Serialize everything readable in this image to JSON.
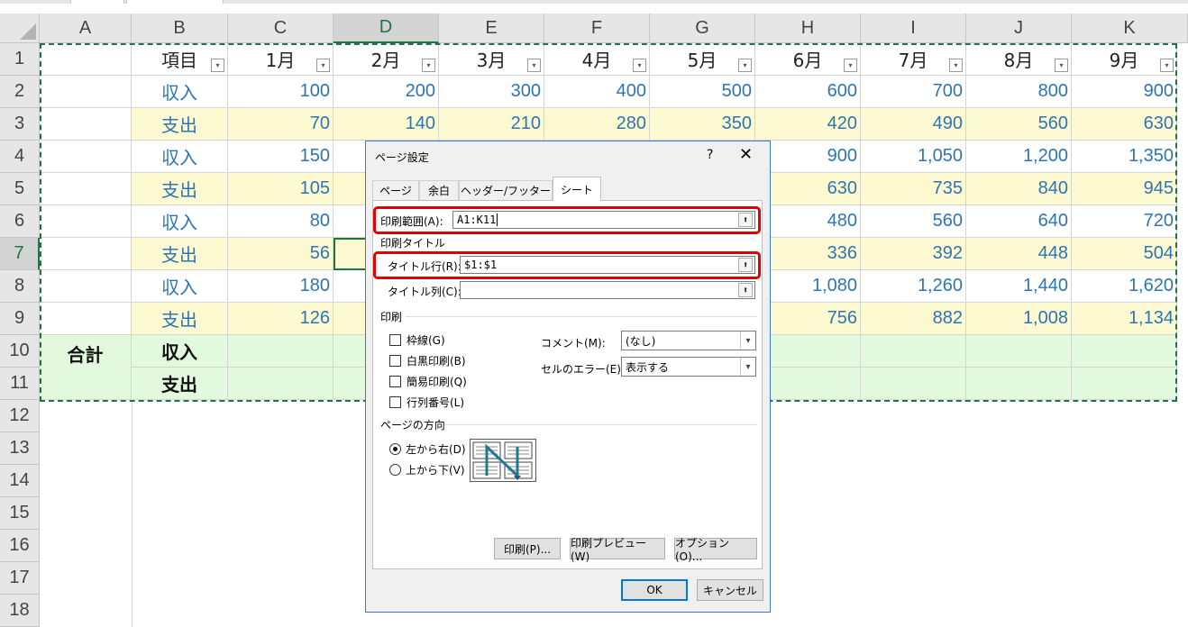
{
  "columns": [
    "A",
    "B",
    "C",
    "D",
    "E",
    "F",
    "G",
    "H",
    "I",
    "J",
    "K"
  ],
  "selected_column": "D",
  "rows": [
    "1",
    "2",
    "3",
    "4",
    "5",
    "6",
    "7",
    "8",
    "9",
    "10",
    "11",
    "12",
    "13",
    "14",
    "15",
    "16",
    "17",
    "18"
  ],
  "selected_row": "7",
  "header_row": [
    "",
    "項目",
    "1月",
    "2月",
    "3月",
    "4月",
    "5月",
    "6月",
    "7月",
    "8月",
    "9月"
  ],
  "data_rows": [
    {
      "item": "収入",
      "values": [
        "100",
        "200",
        "300",
        "400",
        "500",
        "600",
        "700",
        "800",
        "900"
      ]
    },
    {
      "item": "支出",
      "values": [
        "70",
        "140",
        "210",
        "280",
        "350",
        "420",
        "490",
        "560",
        "630"
      ]
    },
    {
      "item": "収入",
      "values": [
        "150",
        "",
        "",
        "",
        "",
        "900",
        "1,050",
        "1,200",
        "1,350"
      ]
    },
    {
      "item": "支出",
      "values": [
        "105",
        "",
        "",
        "",
        "",
        "630",
        "735",
        "840",
        "945"
      ]
    },
    {
      "item": "収入",
      "values": [
        "80",
        "",
        "",
        "",
        "",
        "480",
        "560",
        "640",
        "720"
      ]
    },
    {
      "item": "支出",
      "values": [
        "56",
        "",
        "",
        "",
        "",
        "336",
        "392",
        "448",
        "504"
      ]
    },
    {
      "item": "収入",
      "values": [
        "180",
        "",
        "",
        "",
        "",
        "1,080",
        "1,260",
        "1,440",
        "1,620"
      ]
    },
    {
      "item": "支出",
      "values": [
        "126",
        "",
        "",
        "",
        "",
        "756",
        "882",
        "1,008",
        "1,134"
      ]
    }
  ],
  "total_rows": {
    "label": "合計",
    "items": [
      "収入",
      "支出"
    ]
  },
  "filter_icon": "▾",
  "dialog": {
    "title": "ページ設定",
    "help": "?",
    "close": "✕",
    "tabs": [
      "ページ",
      "余白",
      "ヘッダー/フッター",
      "シート"
    ],
    "active_tab": "シート",
    "print_area_label": "印刷範囲(A):",
    "print_area_value": "A1:K11",
    "print_titles_section": "印刷タイトル",
    "title_rows_label": "タイトル行(R):",
    "title_rows_value": "$1:$1",
    "title_cols_label": "タイトル列(C):",
    "title_cols_value": "",
    "collapse_icon": "⬆",
    "print_section": "印刷",
    "checkboxes": [
      "枠線(G)",
      "白黒印刷(B)",
      "簡易印刷(Q)",
      "行列番号(L)"
    ],
    "comments_label": "コメント(M):",
    "comments_value": "(なし)",
    "errors_label": "セルのエラー(E):",
    "errors_value": "表示する",
    "order_section": "ページの方向",
    "order_options": [
      "左から右(D)",
      "上から下(V)"
    ],
    "order_selected": 0,
    "print_button": "印刷(P)...",
    "preview_button": "印刷プレビュー(W)",
    "options_button": "オプション(O)...",
    "ok_button": "OK",
    "cancel_button": "キャンセル",
    "colors": {
      "accent": "#0078d7",
      "highlight": "#e00000"
    }
  },
  "colors": {
    "value_text": "#2e75b6",
    "band_yellow": "#fdf9d1",
    "total_green": "#e2f9de",
    "excel_green": "#217346"
  }
}
